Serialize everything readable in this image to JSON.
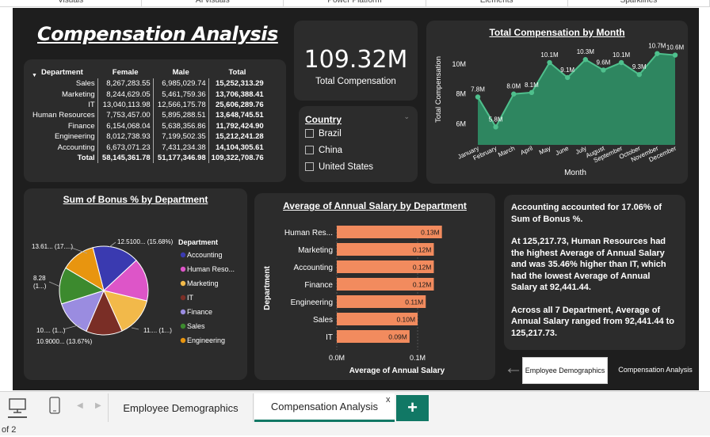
{
  "ribbon": {
    "items": [
      "Visuals",
      "AI visuals",
      "Power Platform",
      "Elements",
      "Sparklines"
    ]
  },
  "report": {
    "title": "Compensation Analysis"
  },
  "matrix": {
    "headers": [
      "Department",
      "Female",
      "Male",
      "Total"
    ],
    "rows": [
      {
        "department": "Sales",
        "female": "8,267,283.55",
        "male": "6,985,029.74",
        "total": "15,252,313.29"
      },
      {
        "department": "Marketing",
        "female": "8,244,629.05",
        "male": "5,461,759.36",
        "total": "13,706,388.41"
      },
      {
        "department": "IT",
        "female": "13,040,113.98",
        "male": "12,566,175.78",
        "total": "25,606,289.76"
      },
      {
        "department": "Human Resources",
        "female": "7,753,457.00",
        "male": "5,895,288.51",
        "total": "13,648,745.51"
      },
      {
        "department": "Finance",
        "female": "6,154,068.04",
        "male": "5,638,356.86",
        "total": "11,792,424.90"
      },
      {
        "department": "Engineering",
        "female": "8,012,738.93",
        "male": "7,199,502.35",
        "total": "15,212,241.28"
      },
      {
        "department": "Accounting",
        "female": "6,673,071.23",
        "male": "7,431,234.38",
        "total": "14,104,305.61"
      }
    ],
    "total_row": {
      "department": "Total",
      "female": "58,145,361.78",
      "male": "51,177,346.98",
      "total": "109,322,708.76"
    }
  },
  "kpi": {
    "value": "109.32M",
    "label": "Total Compensation"
  },
  "slicer": {
    "title": "Country",
    "options": [
      "Brazil",
      "China",
      "United States"
    ]
  },
  "line_chart": {
    "chart_data": {
      "type": "area",
      "title": "Total Compensation by Month",
      "xlabel": "Month",
      "ylabel": "Total Compensation",
      "categories": [
        "January",
        "February",
        "March",
        "April",
        "May",
        "June",
        "July",
        "August",
        "September",
        "October",
        "November",
        "December"
      ],
      "values": [
        7.8,
        5.8,
        8.0,
        8.1,
        10.1,
        9.1,
        10.3,
        9.6,
        10.1,
        9.3,
        10.7,
        10.6
      ],
      "data_labels": [
        "7.8M",
        "5.8M",
        "8.0M",
        "8.1M",
        "10.1M",
        "9.1M",
        "10.3M",
        "9.6M",
        "10.1M",
        "9.3M",
        "10.7M",
        "10.6M"
      ],
      "y_ticks": [
        {
          "value": 6,
          "label": "6M"
        },
        {
          "value": 8,
          "label": "8M"
        },
        {
          "value": 10,
          "label": "10M"
        }
      ],
      "ylim": [
        4.6,
        11.0
      ],
      "color": "#2e8b63",
      "line_color": "#4fc08d"
    }
  },
  "pie_chart": {
    "chart_data": {
      "type": "pie",
      "title": "Sum of Bonus % by Department",
      "legend_title": "Department",
      "slices": [
        {
          "name": "Accounting",
          "value": 17.06,
          "color": "#3a3ab0"
        },
        {
          "name": "Human Reso...",
          "value": 15.68,
          "color": "#dd55c8"
        },
        {
          "name": "Marketing",
          "value": 14.5,
          "color": "#f2b94a"
        },
        {
          "name": "IT",
          "value": 13.2,
          "color": "#7a2e26"
        },
        {
          "name": "Finance",
          "value": 13.67,
          "color": "#9a8ce0"
        },
        {
          "name": "Sales",
          "value": 13.4,
          "color": "#3c8a2e"
        },
        {
          "name": "Engineering",
          "value": 12.49,
          "color": "#e8950f"
        }
      ],
      "data_labels": [
        "13.61... (17....)",
        "12.5100... (15.68%)",
        "8.28 (1...)",
        "10.... (1...)",
        "10.9000... (13.67%)",
        "11.... (1...)"
      ]
    }
  },
  "bar_chart": {
    "chart_data": {
      "type": "bar",
      "title": "Average of Annual Salary by Department",
      "xlabel": "Average of Annual Salary",
      "ylabel": "Department",
      "categories": [
        "Human Res...",
        "Marketing",
        "Accounting",
        "Finance",
        "Engineering",
        "Sales",
        "IT"
      ],
      "values": [
        0.13,
        0.12,
        0.12,
        0.12,
        0.11,
        0.1,
        0.09
      ],
      "data_labels": [
        "0.13M",
        "0.12M",
        "0.12M",
        "0.12M",
        "0.11M",
        "0.10M",
        "0.09M"
      ],
      "x_ticks": [
        {
          "value": 0,
          "label": "0.0M"
        },
        {
          "value": 0.1,
          "label": "0.1M"
        }
      ],
      "xlim": [
        0,
        0.145
      ],
      "color": "#f28b5e"
    }
  },
  "narrative": {
    "p1": "Accounting accounted for 17.06% of Sum of Bonus %.",
    "p2": "At 125,217.73, Human Resources had the highest Average of Annual Salary and was 35.46% higher than IT, which had the lowest Average of Annual Salary at 92,441.44.",
    "p3": "Across all 7 Department, Average of Annual Salary ranged from 92,441.44 to 125,217.73."
  },
  "nav": {
    "back_arrow": "←",
    "button1": "Employee Demographics",
    "button2": "Compensation Analysis"
  },
  "page_tabs": {
    "tab1": "Employee Demographics",
    "tab2": "Compensation Analysis",
    "close": "x",
    "add": "+"
  },
  "status": {
    "page": "of 2"
  }
}
